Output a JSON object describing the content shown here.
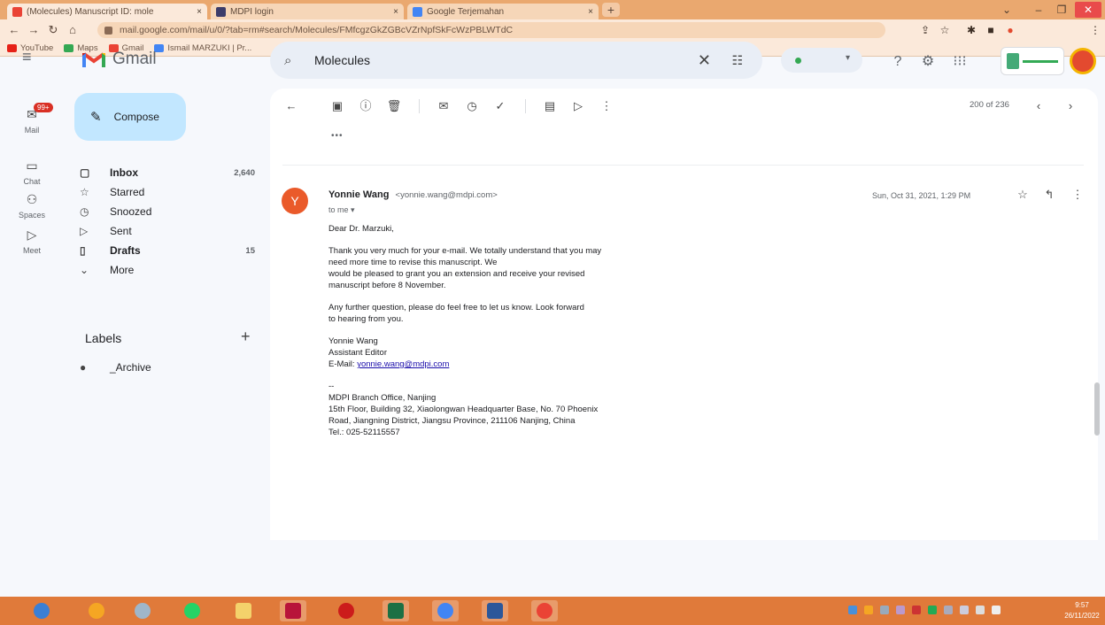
{
  "browser": {
    "tabs": [
      {
        "title": "(Molecules) Manuscript ID: mole",
        "close": "×"
      },
      {
        "title": "MDPI login",
        "close": "×"
      },
      {
        "title": "Google Terjemahan",
        "close": "×"
      }
    ],
    "new_tab": "+",
    "url": "mail.google.com/mail/u/0/?tab=rm#search/Molecules/FMfcgzGkZGBcVZrNpfSkFcWzPBLWTdC",
    "bookmarks": [
      "YouTube",
      "Maps",
      "Gmail",
      "Ismail MARZUKI | Pr..."
    ]
  },
  "gmail": {
    "product": "Gmail",
    "compose": "Compose",
    "search": {
      "query": "Molecules"
    },
    "rail": [
      {
        "label": "Mail",
        "badge": "99+"
      },
      {
        "label": "Chat"
      },
      {
        "label": "Spaces"
      },
      {
        "label": "Meet"
      }
    ],
    "nav": [
      {
        "label": "Inbox",
        "count": "2,640",
        "bold": true
      },
      {
        "label": "Starred",
        "count": ""
      },
      {
        "label": "Snoozed",
        "count": ""
      },
      {
        "label": "Sent",
        "count": ""
      },
      {
        "label": "Drafts",
        "count": "15",
        "bold": true
      },
      {
        "label": "More",
        "count": ""
      }
    ],
    "labels_title": "Labels",
    "labels": [
      "_Archive"
    ],
    "pager": "200 of 236",
    "prev_collapsed": "•••"
  },
  "message": {
    "avatar_letter": "Y",
    "sender_name": "Yonnie Wang",
    "sender_email": "<yonnie.wang@mdpi.com>",
    "to": "to me ▾",
    "date": "Sun, Oct 31, 2021, 1:29 PM",
    "body": {
      "greeting": "Dear Dr. Marzuki,",
      "p1_line1": "Thank you very much for your e-mail. We totally understand that you may",
      "p1_line2": "need more time to revise this manuscript. We",
      "p1_line3": "would be pleased to grant you an extension and receive your revised",
      "p1_line4": "manuscript before 8 November.",
      "p2_line1": "Any further question, please do feel free to let us know. Look forward",
      "p2_line2": "to hearing from you.",
      "sig_name": "Yonnie Wang",
      "sig_title": "Assistant Editor",
      "sig_email_label": "E-Mail:",
      "sig_email": "yonnie.wang@mdpi.com",
      "sig_sep": "--",
      "office1": "MDPI Branch Office, Nanjing",
      "office2": "15th Floor, Building 32, Xiaolongwan Headquarter Base, No. 70 Phoenix",
      "office3": "Road, Jiangning District, Jiangsu Province, 211106 Nanjing, China",
      "office4": "Tel.: 025-52115557"
    }
  },
  "taskbar": {
    "clock_time": "9:57",
    "clock_date": "26/11/2022"
  },
  "colors": {
    "chrome_tabstrip": "#eaa86f",
    "chrome_toolbar": "#fbe9da",
    "gmail_bg": "#f6f8fc",
    "compose": "#c2e7ff",
    "avatar_sender": "#ea5a2a",
    "taskbar": "#e07a3a"
  }
}
